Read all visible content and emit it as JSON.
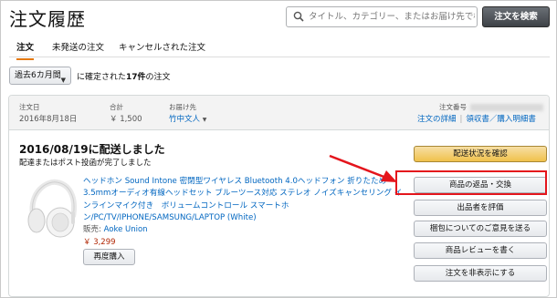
{
  "page": {
    "title": "注文履歴"
  },
  "search": {
    "placeholder": "タイトル、カテゴリー、またはお届け先で検索",
    "button_label": "注文を検索"
  },
  "tabs": [
    {
      "label": "注文",
      "active": true
    },
    {
      "label": "未発送の注文",
      "active": false
    },
    {
      "label": "キャンセルされた注文",
      "active": false
    }
  ],
  "filter": {
    "period_selected": "過去6カ月間",
    "text_prefix": "に確定された",
    "count": "17件",
    "text_suffix": "の注文"
  },
  "order": {
    "date_label": "注文日",
    "date_value": "2016年8月18日",
    "total_label": "合計",
    "total_value": "￥ 1,500",
    "ship_to_label": "お届け先",
    "ship_to_value": "竹中文人",
    "order_number_label": "注文番号",
    "detail_link": "注文の詳細",
    "receipt_link": "領収書／購入明細書",
    "ship_status": "2016/08/19に配送しました",
    "ship_note": "配達またはポスト投函が完了しました",
    "product": {
      "title": "ヘッドホン Sound Intone 密閉型ワイヤレス Bluetooth 4.0ヘッドフォン 折りたため 3.5mmオーディオ有線ヘッドセット ブルーツース対応 ステレオ ノイズキャンセリング インラインマイク付き　ボリュームコントロール スマートホン/PC/TV/IPHONE/SAMSUNG/LAPTOP (White)",
      "seller_label": "販売:",
      "seller_name": "Aoke Union",
      "price": "￥ 3,299",
      "rebuy_label": "再度購入"
    },
    "actions": [
      {
        "label": "配送状況を確認",
        "primary": true
      },
      {
        "label": "商品の返品・交換",
        "primary": false
      },
      {
        "label": "出品者を評価",
        "primary": false
      },
      {
        "label": "梱包についてのご意見を送る",
        "primary": false
      },
      {
        "label": "商品レビューを書く",
        "primary": false
      },
      {
        "label": "注文を非表示にする",
        "primary": false
      }
    ]
  },
  "colors": {
    "link": "#0066c0",
    "price": "#b12704",
    "tab_underline": "#e47911",
    "annotation": "#e4151c"
  }
}
